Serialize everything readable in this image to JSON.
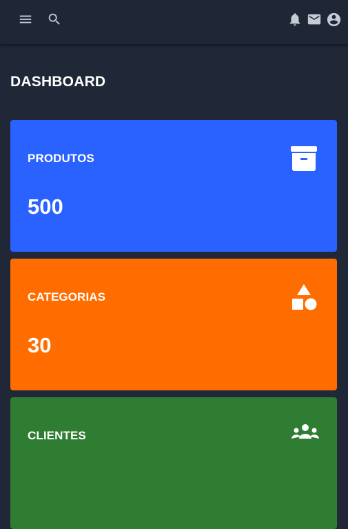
{
  "header": {
    "icons": [
      "menu-icon",
      "search-icon",
      "bell-icon",
      "mail-icon",
      "account-circle-icon"
    ],
    "icon_color": "#c7ccd4"
  },
  "page": {
    "title": "DASHBOARD"
  },
  "cards": [
    {
      "label": "PRODUTOS",
      "value": "500",
      "icon": "archive-box-icon",
      "color": "#2962ff"
    },
    {
      "label": "CATEGORIAS",
      "value": "30",
      "icon": "shapes-icon",
      "color": "#ff6d00"
    },
    {
      "label": "CLIENTES",
      "value": "",
      "icon": "people-group-icon",
      "color": "#2e7d32"
    }
  ],
  "theme": {
    "background": "#202837",
    "text": "#ffffff"
  }
}
